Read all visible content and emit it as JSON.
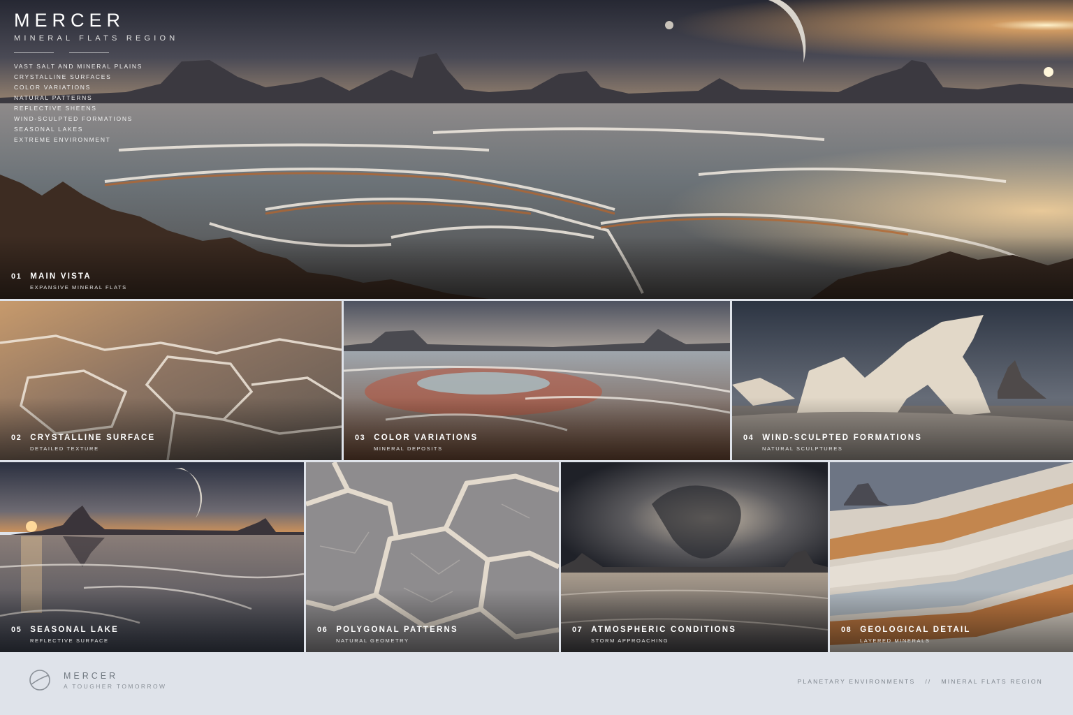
{
  "brand": {
    "name": "MERCER",
    "region": "MINERAL FLATS REGION",
    "features": [
      "VAST SALT AND MINERAL PLAINS",
      "CRYSTALLINE SURFACES",
      "COLOR VARIATIONS",
      "NATURAL PATTERNS",
      "REFLECTIVE SHEENS",
      "WIND-SCULPTED FORMATIONS",
      "SEASONAL LAKES",
      "EXTREME ENVIRONMENT"
    ]
  },
  "panels": [
    {
      "num": "01",
      "title": "MAIN VISTA",
      "subtitle": "EXPANSIVE MINERAL FLATS"
    },
    {
      "num": "02",
      "title": "CRYSTALLINE SURFACE",
      "subtitle": "DETAILED TEXTURE"
    },
    {
      "num": "03",
      "title": "COLOR VARIATIONS",
      "subtitle": "MINERAL DEPOSITS"
    },
    {
      "num": "04",
      "title": "WIND-SCULPTED FORMATIONS",
      "subtitle": "NATURAL SCULPTURES"
    },
    {
      "num": "05",
      "title": "SEASONAL LAKE",
      "subtitle": "REFLECTIVE SURFACE"
    },
    {
      "num": "06",
      "title": "POLYGONAL PATTERNS",
      "subtitle": "NATURAL GEOMETRY"
    },
    {
      "num": "07",
      "title": "ATMOSPHERIC CONDITIONS",
      "subtitle": "STORM APPROACHING"
    },
    {
      "num": "08",
      "title": "GEOLOGICAL DETAIL",
      "subtitle": "LAYERED MINERALS"
    }
  ],
  "footer": {
    "name": "MERCER",
    "tagline": "A TOUGHER TOMORROW",
    "category": "PLANETARY ENVIRONMENTS",
    "separator": "//",
    "region": "MINERAL FLATS REGION",
    "emblem_icon": "planet-ring-icon"
  },
  "colors": {
    "sky_dark": "#2c2f3a",
    "sunset_orange": "#f0a050",
    "salt_white": "#e9e4dc",
    "mineral_rust": "#a0522d",
    "footer_bg": "#dfe3ea"
  }
}
